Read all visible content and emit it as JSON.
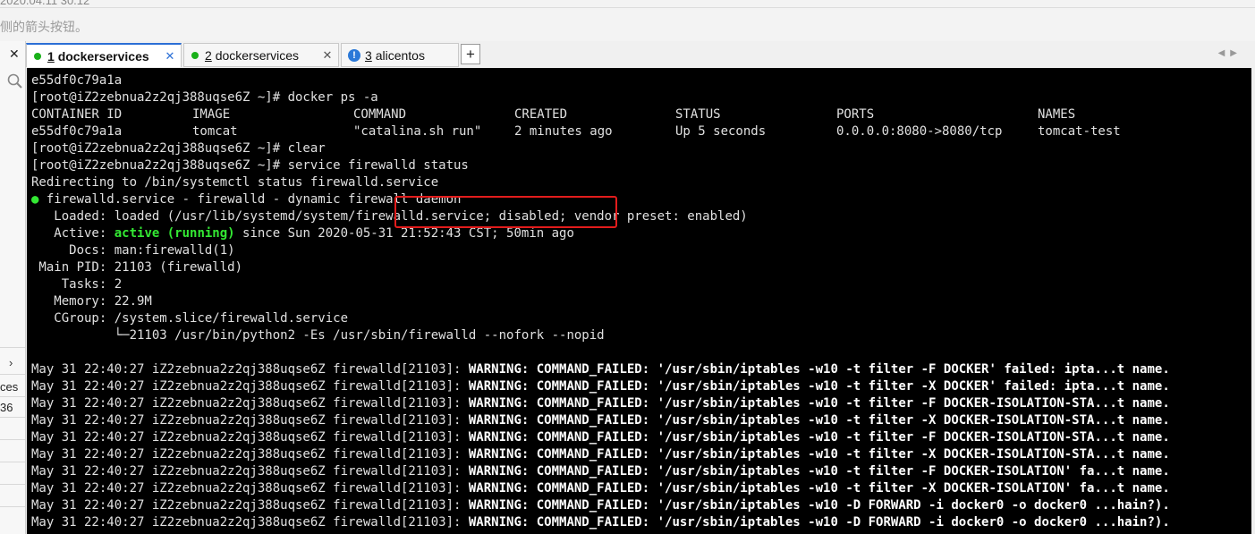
{
  "top": {
    "crumb_text": "2020.04.11 30.12",
    "hint_text": "侧的箭头按钮。"
  },
  "sidebar": {
    "close_glyph": "✕",
    "expand_glyph": "›",
    "cells": [
      "ces",
      "36"
    ]
  },
  "tabs": [
    {
      "num": "1",
      "name": "dockerservices",
      "status": "connected",
      "active": true,
      "close": "✕"
    },
    {
      "num": "2",
      "name": "dockerservices",
      "status": "connected",
      "active": false,
      "close": "✕"
    },
    {
      "num": "3",
      "name": "alicentos",
      "status": "warning",
      "active": false,
      "close": "✕"
    }
  ],
  "tab_add_label": "+",
  "tab_warning_glyph": "!",
  "tab_nav_arrows": "◀▶",
  "colors": {
    "accent": "#2b6fd6",
    "connected": "#19b019",
    "warning_badge": "#2b79d8",
    "terminal_bg": "#000000",
    "terminal_fg": "#e0e0e0",
    "terminal_green": "#33e833",
    "highlight_box": "#e21c1c"
  },
  "terminal": {
    "line1": "e55df0c79a1a",
    "line2": "[root@iZ2zebnua2z2qj388uqse6Z ~]# docker ps -a",
    "header": {
      "id": "CONTAINER ID",
      "image": "IMAGE",
      "command": "COMMAND",
      "created": "CREATED",
      "status": "STATUS",
      "ports": "PORTS",
      "names": "NAMES"
    },
    "row": {
      "id": "e55df0c79a1a",
      "image": "tomcat",
      "command": "\"catalina.sh run\"",
      "created": "2 minutes ago",
      "status": "Up 5 seconds",
      "ports": "0.0.0.0:8080->8080/tcp",
      "names": "tomcat-test"
    },
    "line5": "[root@iZ2zebnua2z2qj388uqse6Z ~]# clear",
    "line6": "[root@iZ2zebnua2z2qj388uqse6Z ~]# service firewalld status",
    "line7": "Redirecting to /bin/systemctl status firewalld.service",
    "status_dot": "●",
    "line8": " firewalld.service - firewalld - dynamic firewall daemon",
    "loaded_label": "   Loaded:",
    "loaded_value": " loaded (/usr/lib/systemd/system/firewalld.service; disabled; vendor preset: enabled)",
    "active_label": "   Active:",
    "active_state": " active (running)",
    "active_rest": " since Sun 2020-05-31 21:52:43 CST; 50min ago",
    "docs": "     Docs: man:firewalld(1)",
    "mainpid": " Main PID: 21103 (firewalld)",
    "tasks": "    Tasks: 2",
    "memory": "   Memory: 22.9M",
    "cgroup": "   CGroup: /system.slice/firewalld.service",
    "cgroup_child": "           └─21103 /usr/bin/python2 -Es /usr/sbin/firewalld --nofork --nopid",
    "log_prefix": "May 31 22:40:27 iZ2zebnua2z2qj388uqse6Z firewalld[21103]: ",
    "log_warn": "WARNING: COMMAND_FAILED: '/usr/sbin/iptables -w10 ",
    "log_rest": [
      "-t filter -F DOCKER' failed: ipta...t name.",
      "-t filter -X DOCKER' failed: ipta...t name.",
      "-t filter -F DOCKER-ISOLATION-STA...t name.",
      "-t filter -X DOCKER-ISOLATION-STA...t name.",
      "-t filter -F DOCKER-ISOLATION-STA...t name.",
      "-t filter -X DOCKER-ISOLATION-STA...t name.",
      "-t filter -F DOCKER-ISOLATION' fa...t name.",
      "-t filter -X DOCKER-ISOLATION' fa...t name.",
      "-D FORWARD -i docker0 -o docker0 ...hain?).",
      "-D FORWARD -i docker0 -o docker0 ...hain?)."
    ]
  }
}
